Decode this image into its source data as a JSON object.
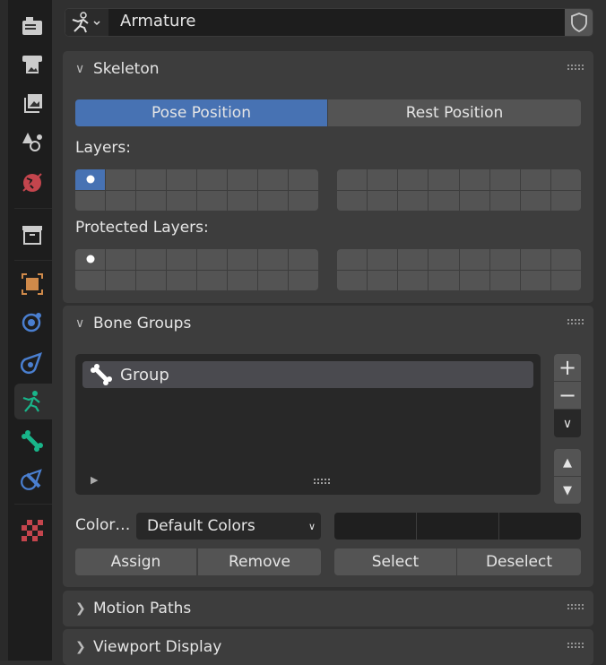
{
  "header": {
    "object_name": "Armature"
  },
  "sidebar": {
    "tabs": [
      "tool",
      "render",
      "output",
      "view-layer",
      "scene",
      "world",
      "collection",
      "object",
      "modifiers",
      "physics",
      "object-data-armature",
      "bone",
      "bone-constraints",
      "texture"
    ],
    "active": "object-data-armature"
  },
  "skeleton": {
    "title": "Skeleton",
    "pose_position": "Pose Position",
    "rest_position": "Rest Position",
    "active": "Pose Position",
    "layers_label": "Layers:",
    "protected_label": "Protected Layers:",
    "active_layer": 0,
    "protected_layer": 0
  },
  "bone_groups": {
    "title": "Bone Groups",
    "items": [
      {
        "name": "Group"
      }
    ],
    "color_label": "Color…",
    "color_set": "Default Colors",
    "assign": "Assign",
    "remove": "Remove",
    "select": "Select",
    "deselect": "Deselect"
  },
  "collapsed_panels": {
    "motion_paths": "Motion Paths",
    "viewport_display": "Viewport Display"
  },
  "colors": {
    "accent": "#4772b3",
    "armature": "#19b58a"
  }
}
